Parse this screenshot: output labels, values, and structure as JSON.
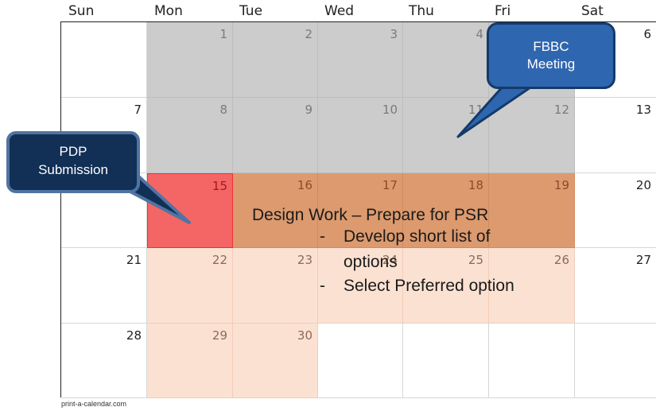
{
  "weekdays": [
    "Sun",
    "Mon",
    "Tue",
    "Wed",
    "Thu",
    "Fri",
    "Sat"
  ],
  "days": {
    "d1": "1",
    "d2": "2",
    "d3": "3",
    "d4": "4",
    "d6": "6",
    "d7": "7",
    "d8": "8",
    "d9": "9",
    "d10": "10",
    "d11": "11",
    "d12": "12",
    "d13": "13",
    "d15": "15",
    "d16": "16",
    "d17": "17",
    "d18": "18",
    "d19": "19",
    "d20": "20",
    "d21": "21",
    "d22": "22",
    "d23": "23",
    "d24": "24",
    "d25": "25",
    "d26": "26",
    "d27": "27",
    "d28": "28",
    "d29": "29",
    "d30": "30"
  },
  "callouts": {
    "fbbc_line1": "FBBC",
    "fbbc_line2": "Meeting",
    "pdp_line1": "PDP",
    "pdp_line2": "Submission"
  },
  "task": {
    "title": "Design Work – Prepare for PSR",
    "bullet_marker": "-",
    "item1_line1": "Develop short list of",
    "item1_line2": "options",
    "item2": "Select Preferred option"
  },
  "footer": "print-a-calendar.com",
  "colors": {
    "grey_block": "#cccccc",
    "red_day": "#f46565",
    "orange_band": "#dc9a6e",
    "peach_block": "#fbe1d1",
    "callout_blue": "#2f66b0",
    "callout_navy": "#122f55"
  }
}
